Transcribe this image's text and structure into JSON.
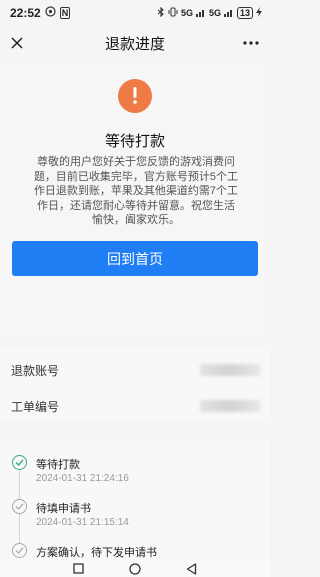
{
  "status_bar": {
    "time": "22:52",
    "network_badges": [
      "5G",
      "5G"
    ],
    "battery": "13"
  },
  "nav": {
    "title": "退款进度"
  },
  "status": {
    "title": "等待打款",
    "description": "尊敬的用户您好关于您反馈的游戏消费问题，目前已收集完毕，官方账号预计5个工作日退款到账，苹果及其他渠道约需7个工作日，还请您耐心等待并留意。祝您生活愉快，阖家欢乐。",
    "button_label": "回到首页",
    "accent_color": "#1f7ef3",
    "warning_color": "#ee7b45"
  },
  "info": {
    "refund_account_label": "退款账号",
    "ticket_number_label": "工单编号"
  },
  "timeline": {
    "steps": [
      {
        "title": "等待打款",
        "time": "2024-01-31 21:24:16",
        "state": "active"
      },
      {
        "title": "待填申请书",
        "time": "2024-01-31 21:15:14",
        "state": "done"
      },
      {
        "title": "方案确认，待下发申请书",
        "time": "",
        "state": "done"
      }
    ],
    "active_color": "#3aa981"
  }
}
